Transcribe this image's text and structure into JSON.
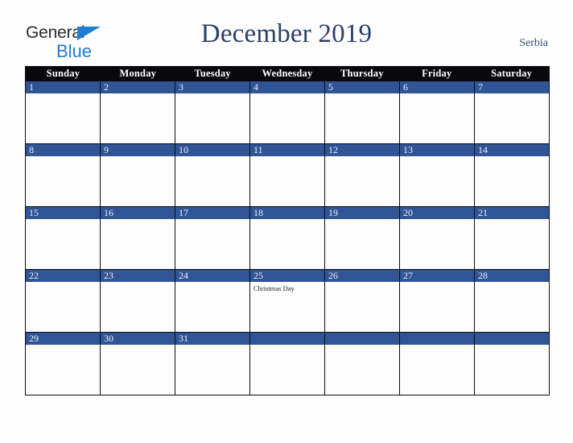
{
  "brand": {
    "name_part1": "General",
    "name_part2": "Blue",
    "triangle_icon": "triangle-icon",
    "color_dark": "#2b2b2b",
    "color_blue": "#1e7fd4"
  },
  "header": {
    "title": "December 2019",
    "country": "Serbia",
    "title_color": "#2b3f68"
  },
  "calendar": {
    "weekday_headers": [
      "Sunday",
      "Monday",
      "Tuesday",
      "Wednesday",
      "Thursday",
      "Friday",
      "Saturday"
    ],
    "header_bg": "#08080d",
    "day_bar_bg": "#2f5597",
    "cell_bg": "#fdfdfd",
    "border_color": "#0d0d12",
    "weeks": [
      [
        {
          "num": "1",
          "events": []
        },
        {
          "num": "2",
          "events": []
        },
        {
          "num": "3",
          "events": []
        },
        {
          "num": "4",
          "events": []
        },
        {
          "num": "5",
          "events": []
        },
        {
          "num": "6",
          "events": []
        },
        {
          "num": "7",
          "events": []
        }
      ],
      [
        {
          "num": "8",
          "events": []
        },
        {
          "num": "9",
          "events": []
        },
        {
          "num": "10",
          "events": []
        },
        {
          "num": "11",
          "events": []
        },
        {
          "num": "12",
          "events": []
        },
        {
          "num": "13",
          "events": []
        },
        {
          "num": "14",
          "events": []
        }
      ],
      [
        {
          "num": "15",
          "events": []
        },
        {
          "num": "16",
          "events": []
        },
        {
          "num": "17",
          "events": []
        },
        {
          "num": "18",
          "events": []
        },
        {
          "num": "19",
          "events": []
        },
        {
          "num": "20",
          "events": []
        },
        {
          "num": "21",
          "events": []
        }
      ],
      [
        {
          "num": "22",
          "events": []
        },
        {
          "num": "23",
          "events": []
        },
        {
          "num": "24",
          "events": []
        },
        {
          "num": "25",
          "events": [
            "Christmas Day"
          ]
        },
        {
          "num": "26",
          "events": []
        },
        {
          "num": "27",
          "events": []
        },
        {
          "num": "28",
          "events": []
        }
      ],
      [
        {
          "num": "29",
          "events": []
        },
        {
          "num": "30",
          "events": []
        },
        {
          "num": "31",
          "events": []
        },
        {
          "num": "",
          "events": []
        },
        {
          "num": "",
          "events": []
        },
        {
          "num": "",
          "events": []
        },
        {
          "num": "",
          "events": []
        }
      ]
    ]
  }
}
